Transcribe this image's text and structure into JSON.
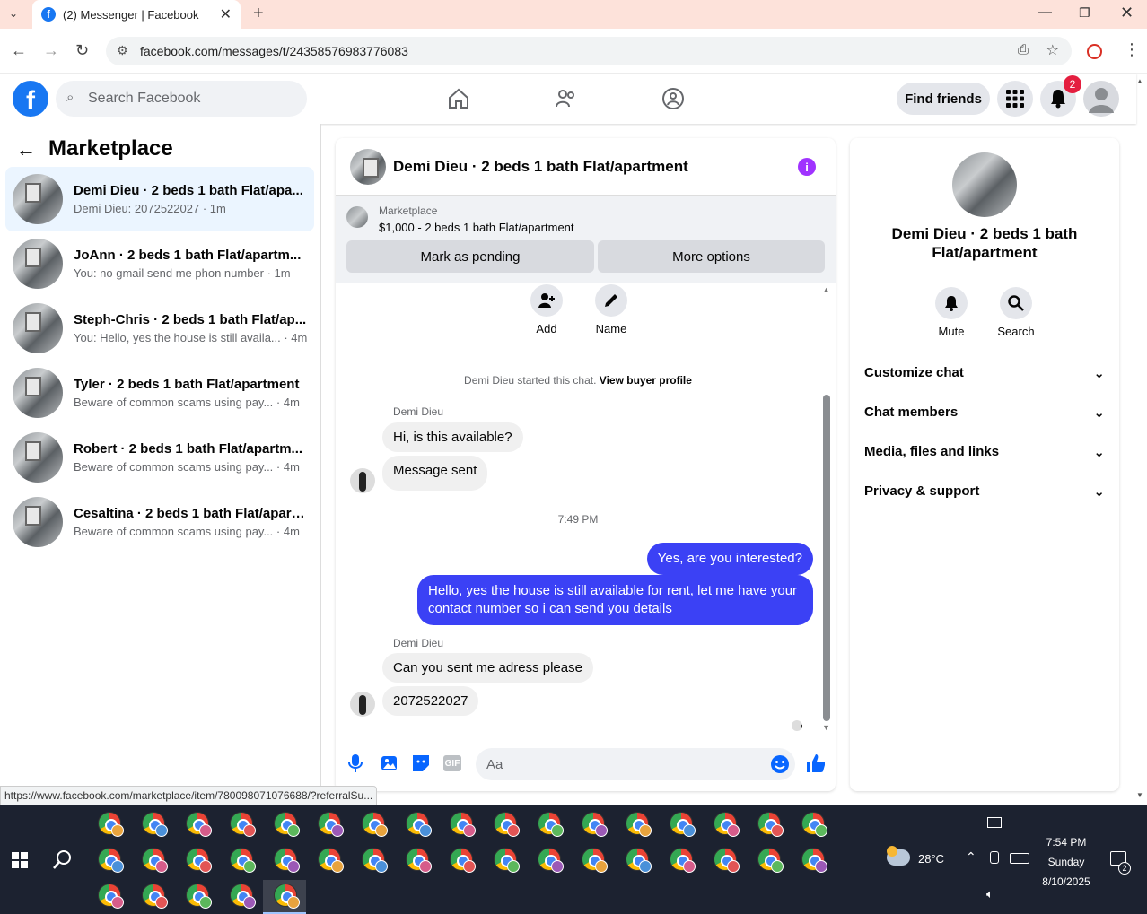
{
  "browser": {
    "tab_title": "(2) Messenger | Facebook",
    "url": "facebook.com/messages/t/24358576983776083",
    "status_url": "https://www.facebook.com/marketplace/item/780098071076688/?referralSu..."
  },
  "header": {
    "search_placeholder": "Search Facebook",
    "find_friends": "Find friends",
    "notification_count": "2"
  },
  "left": {
    "title": "Marketplace",
    "conversations": [
      {
        "title": "Demi Dieu · 2 beds 1 bath Flat/apa...",
        "preview": "Demi Dieu: 2072522027 · 1m"
      },
      {
        "title": "JoAnn · 2 beds 1 bath Flat/apartm...",
        "preview": "You: no gmail send me phon number · 1m"
      },
      {
        "title": "Steph-Chris · 2 beds 1 bath Flat/ap...",
        "preview": "You: Hello, yes the house is still availa... · 4m"
      },
      {
        "title": "Tyler · 2 beds 1 bath Flat/apartment",
        "preview": "Beware of common scams using pay... · 4m"
      },
      {
        "title": "Robert · 2 beds 1 bath Flat/apartm...",
        "preview": "Beware of common scams using pay... · 4m"
      },
      {
        "title": "Cesaltina · 2 beds 1 bath Flat/apart...",
        "preview": "Beware of common scams using pay... · 4m"
      }
    ]
  },
  "chat": {
    "title": "Demi Dieu · 2 beds 1 bath Flat/apartment",
    "marketplace_label": "Marketplace",
    "listing": "$1,000 - 2 beds 1 bath Flat/apartment",
    "mark_pending": "Mark as pending",
    "more_options": "More options",
    "add_label": "Add",
    "name_label": "Name",
    "started_text": "Demi Dieu started this chat.",
    "view_profile": "View buyer profile",
    "sender1": "Demi Dieu",
    "msg1": "Hi, is this available?",
    "msg2": "Message sent",
    "time": "7:49 PM",
    "out1": "Yes, are you interested?",
    "out2": "Hello, yes the house is still available for rent, let me have your contact number so i can send you details",
    "sender2": "Demi Dieu",
    "msg3": "Can you sent me adress please",
    "msg4": "2072522027",
    "input_placeholder": "Aa"
  },
  "details": {
    "title": "Demi Dieu · 2 beds 1 bath Flat/apartment",
    "mute": "Mute",
    "search": "Search",
    "sections": [
      "Customize chat",
      "Chat members",
      "Media, files and links",
      "Privacy & support"
    ]
  },
  "taskbar": {
    "weather": "28°C",
    "time": "7:54 PM",
    "day": "Sunday",
    "date": "8/10/2025",
    "notif_count": "2"
  },
  "colors": {
    "accent": "#1877f2",
    "outgoing_bubble": "#3b41f5",
    "active_conversation": "#ebf5ff"
  }
}
